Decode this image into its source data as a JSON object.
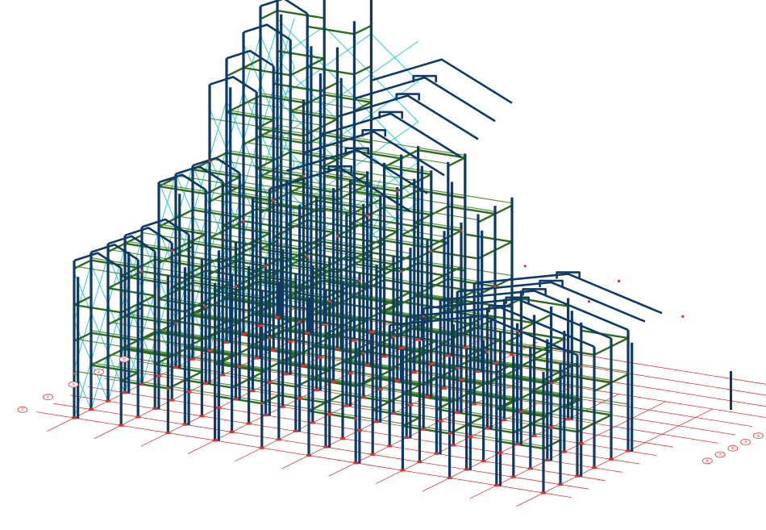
{
  "colors": {
    "column": "#0f3a66",
    "beam": "#2f6b1e",
    "beam_edge": "#4a8a30",
    "bracing": "#37c7d9",
    "grid": "#e23a3a",
    "node": "#e03030"
  },
  "grid_bubbles": [
    "①",
    "②",
    "③",
    "④",
    "⑤",
    "⑥",
    "⑦",
    "⑧",
    "⑨",
    "⑩",
    "Ⓐ",
    "Ⓑ",
    "Ⓒ",
    "Ⓓ",
    "Ⓔ"
  ]
}
